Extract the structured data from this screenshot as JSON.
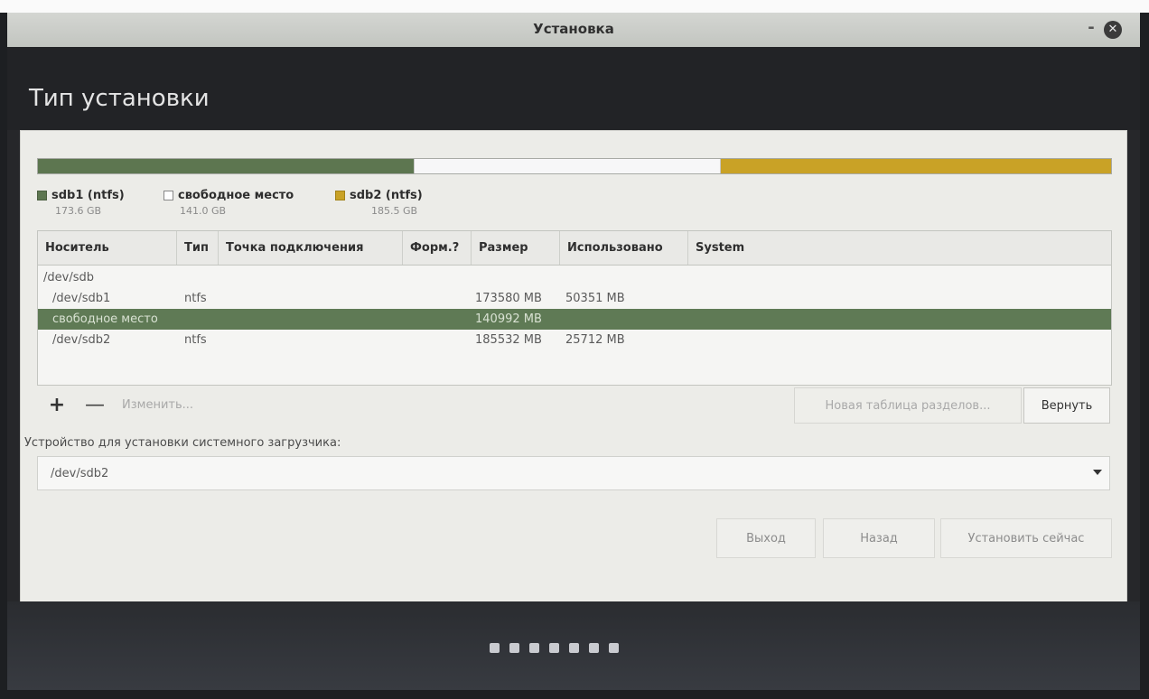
{
  "window": {
    "title": "Установка"
  },
  "header": {
    "title": "Тип установки"
  },
  "partition_bar": {
    "segments": [
      {
        "name": "sdb1 (ntfs)",
        "size": "173.6 GB",
        "color": "#5d7650"
      },
      {
        "name": "свободное место",
        "size": "141.0 GB",
        "color": "#f7f7f8"
      },
      {
        "name": "sdb2 (ntfs)",
        "size": "185.5 GB",
        "color": "#c9a226"
      }
    ]
  },
  "table": {
    "columns": [
      "Носитель",
      "Тип",
      "Точка подключения",
      "Форм.?",
      "Размер",
      "Использовано",
      "System"
    ],
    "rows": [
      {
        "device": "/dev/sdb",
        "type": "",
        "mount": "",
        "format": "",
        "size": "",
        "used": "",
        "system": ""
      },
      {
        "device": "/dev/sdb1",
        "type": "ntfs",
        "mount": "",
        "format": "",
        "size": "173580 MB",
        "used": "50351 MB",
        "system": ""
      },
      {
        "device": "свободное место",
        "type": "",
        "mount": "",
        "format": "",
        "size": "140992 MB",
        "used": "",
        "system": ""
      },
      {
        "device": "/dev/sdb2",
        "type": "ntfs",
        "mount": "",
        "format": "",
        "size": "185532 MB",
        "used": "25712 MB",
        "system": ""
      }
    ]
  },
  "toolbar": {
    "add": "+",
    "remove": "—",
    "change": "Изменить...",
    "new_table": "Новая таблица разделов...",
    "revert": "Вернуть"
  },
  "bootloader": {
    "label": "Устройство для установки системного загрузчика:",
    "value": "/dev/sdb2"
  },
  "actions": {
    "quit": "Выход",
    "back": "Назад",
    "install": "Установить сейчас"
  },
  "progress": {
    "steps": 7
  },
  "colors": {
    "selection": "#5f7a55",
    "header_bg": "#222326",
    "content_bg": "#ecece8"
  }
}
